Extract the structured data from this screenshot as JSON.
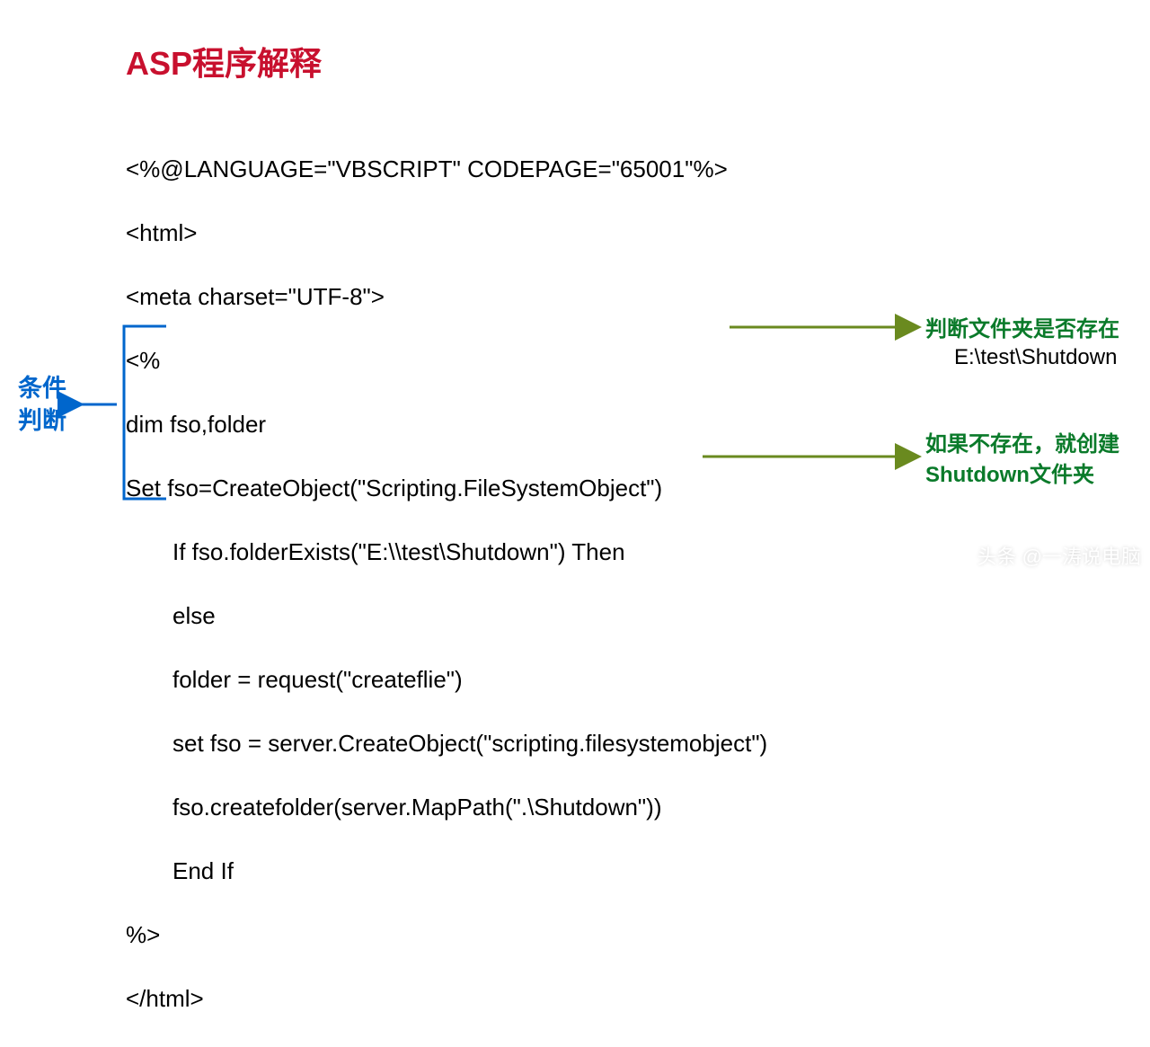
{
  "title": "ASP程序解释",
  "code": {
    "line1": "<%@LANGUAGE=\"VBSCRIPT\" CODEPAGE=\"65001\"%>",
    "line2": "<html>",
    "line3": "<meta charset=\"UTF-8\">",
    "line4": "<%",
    "line5": "dim fso,folder",
    "line6": "Set fso=CreateObject(\"Scripting.FileSystemObject\")",
    "line7": "If fso.folderExists(\"E:\\\\test\\Shutdown\") Then",
    "line8": "else",
    "line9": "folder = request(\"createflie\")",
    "line10": "set fso = server.CreateObject(\"scripting.filesystemobject\")",
    "line11": "fso.createfolder(server.MapPath(\".\\Shutdown\"))",
    "line12": "End If",
    "line13": "%>",
    "line14": "</html>"
  },
  "left_label_l1": "条件",
  "left_label_l2": "判断",
  "note1": "判断文件夹是否存在",
  "note1_sub": "E:\\test\\Shutdown",
  "note2_part1": "如果不存在，就创建",
  "note2_part2a": "Shutdown",
  "note2_part2b": "文件夹",
  "watermark": "头条 @一涛说电脑"
}
